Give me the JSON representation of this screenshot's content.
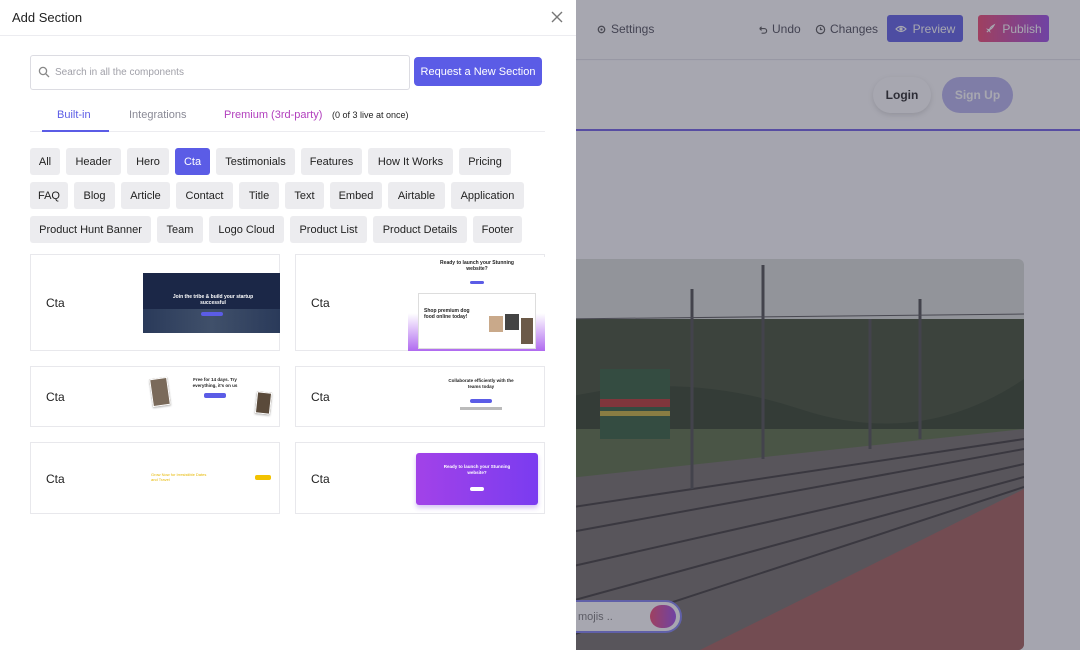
{
  "toolbar": {
    "settings_label": "Settings",
    "undo_label": "Undo",
    "changes_label": "Changes",
    "preview_label": "Preview",
    "publish_label": "Publish"
  },
  "site": {
    "login_label": "Login",
    "signup_label": "Sign Up",
    "chat_placeholder": "mojis .."
  },
  "panel": {
    "title": "Add Section",
    "search_placeholder": "Search in all the components",
    "request_button": "Request a New Section",
    "tabs": {
      "builtin": "Built-in",
      "integrations": "Integrations",
      "premium": "Premium (3rd-party)",
      "premium_note": "(0 of 3 live at once)"
    },
    "categories": [
      "All",
      "Header",
      "Hero",
      "Cta",
      "Testimonials",
      "Features",
      "How It Works",
      "Pricing",
      "FAQ",
      "Blog",
      "Article",
      "Contact",
      "Title",
      "Text",
      "Embed",
      "Airtable",
      "Application",
      "Product Hunt Banner",
      "Team",
      "Logo Cloud",
      "Product List",
      "Product Details",
      "Footer"
    ],
    "active_category": "Cta",
    "cards": [
      {
        "label": "Cta",
        "thumb_text": "Join the tribe & build your startup successful"
      },
      {
        "label": "Cta",
        "thumb_text": "Ready to launch your Stunning website?",
        "thumb_text2": "Shop premium dog food online today!"
      },
      {
        "label": "Cta",
        "thumb_text": "Free for 14 days. Try everything, it's on us"
      },
      {
        "label": "Cta",
        "thumb_text": "Collaborate efficiently with the teams today"
      },
      {
        "label": "Cta",
        "thumb_text": "Grow Now for Irresistible Dates and Travel"
      },
      {
        "label": "Cta",
        "thumb_text": "Ready to launch your Stunning website?"
      }
    ]
  },
  "colors": {
    "accent": "#5b5ce6",
    "premium": "#b13fbd",
    "publish_gradient": [
      "#f0446e",
      "#9a49e8"
    ]
  },
  "icons": {
    "close": "close-icon",
    "search": "search-icon",
    "settings": "gear-icon",
    "undo": "undo-icon",
    "changes": "history-icon",
    "preview": "eye-icon",
    "publish": "rocket-icon",
    "send": "send-icon"
  }
}
